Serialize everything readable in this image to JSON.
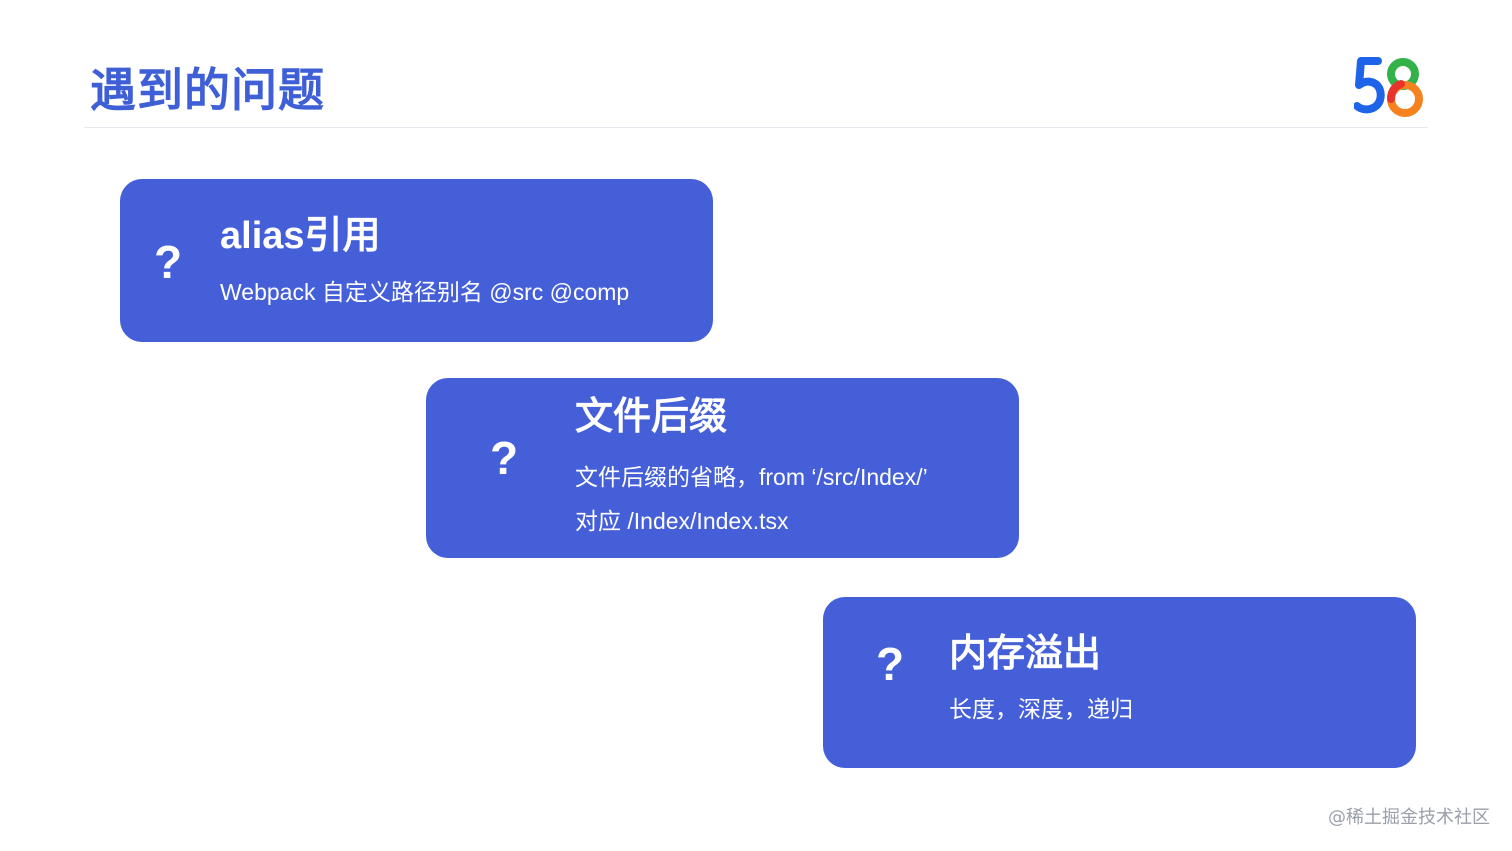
{
  "slide": {
    "title": "遇到的问题",
    "logo_text": "58"
  },
  "cards": [
    {
      "mark": "?",
      "title": "alias引用",
      "lines": [
        "Webpack 自定义路径别名 @src @comp"
      ]
    },
    {
      "mark": "?",
      "title": "文件后缀",
      "lines": [
        "文件后缀的省略，from ‘/src/Index/’",
        "对应 /Index/Index.tsx"
      ]
    },
    {
      "mark": "?",
      "title": "内存溢出",
      "lines": [
        "长度，深度，递归"
      ]
    }
  ],
  "watermark": "@稀土掘金技术社区",
  "colors": {
    "title": "#3e5fd6",
    "card_bg": "#455fd8",
    "card_text": "#ffffff",
    "logo_five": "#1f63e8",
    "logo_eight_top": "#33b24a",
    "logo_eight_bottom": "#f5821f",
    "logo_eight_left": "#e8332c"
  }
}
